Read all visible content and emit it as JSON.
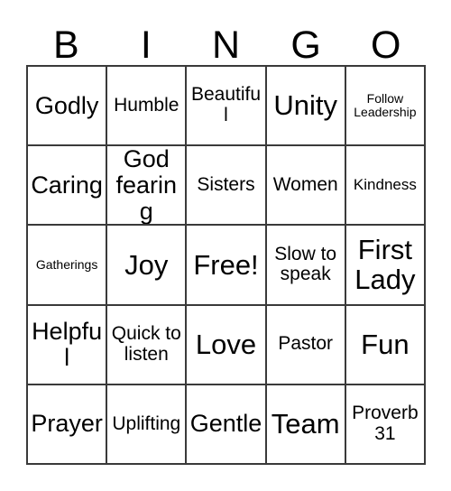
{
  "card": {
    "header_letters": [
      "B",
      "I",
      "N",
      "G",
      "O"
    ],
    "rows": [
      [
        {
          "text": "Godly",
          "size": "lg"
        },
        {
          "text": "Humble",
          "size": "md"
        },
        {
          "text": "Beautiful",
          "size": "md"
        },
        {
          "text": "Unity",
          "size": "xl"
        },
        {
          "text": "Follow Leadership",
          "size": "xs"
        }
      ],
      [
        {
          "text": "Caring",
          "size": "lg"
        },
        {
          "text": "God fearing",
          "size": "lg"
        },
        {
          "text": "Sisters",
          "size": "md"
        },
        {
          "text": "Women",
          "size": "md"
        },
        {
          "text": "Kindness",
          "size": "sm"
        }
      ],
      [
        {
          "text": "Gatherings",
          "size": "xs"
        },
        {
          "text": "Joy",
          "size": "xl"
        },
        {
          "text": "Free!",
          "size": "xl"
        },
        {
          "text": "Slow to speak",
          "size": "md"
        },
        {
          "text": "First Lady",
          "size": "xl"
        }
      ],
      [
        {
          "text": "Helpful",
          "size": "lg"
        },
        {
          "text": "Quick to listen",
          "size": "md"
        },
        {
          "text": "Love",
          "size": "xl"
        },
        {
          "text": "Pastor",
          "size": "md"
        },
        {
          "text": "Fun",
          "size": "xl"
        }
      ],
      [
        {
          "text": "Prayer",
          "size": "lg"
        },
        {
          "text": "Uplifting",
          "size": "md"
        },
        {
          "text": "Gentle",
          "size": "lg"
        },
        {
          "text": "Team",
          "size": "xl"
        },
        {
          "text": "Proverb 31",
          "size": "md"
        }
      ]
    ],
    "colors": {
      "background": "#ffffff",
      "grid_line": "#3a3a3a",
      "text": "#000000"
    }
  }
}
